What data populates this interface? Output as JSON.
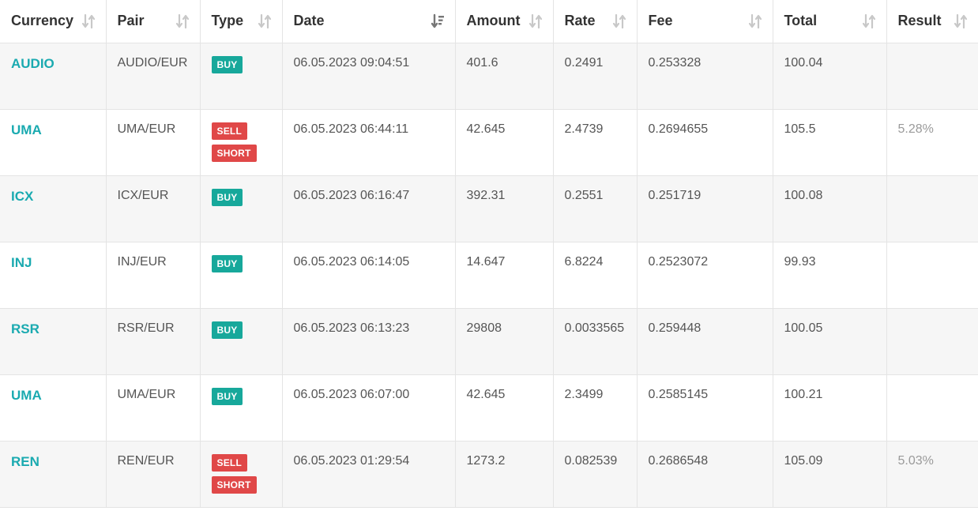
{
  "columns": [
    {
      "key": "currency",
      "label": "Currency",
      "sort": "none"
    },
    {
      "key": "pair",
      "label": "Pair",
      "sort": "none"
    },
    {
      "key": "type",
      "label": "Type",
      "sort": "none"
    },
    {
      "key": "date",
      "label": "Date",
      "sort": "desc-active"
    },
    {
      "key": "amount",
      "label": "Amount",
      "sort": "none"
    },
    {
      "key": "rate",
      "label": "Rate",
      "sort": "none"
    },
    {
      "key": "fee",
      "label": "Fee",
      "sort": "none"
    },
    {
      "key": "total",
      "label": "Total",
      "sort": "none"
    },
    {
      "key": "result",
      "label": "Result",
      "sort": "none"
    }
  ],
  "rows": [
    {
      "currency": "AUDIO",
      "pair": "AUDIO/EUR",
      "types": [
        "BUY"
      ],
      "date": "06.05.2023 09:04:51",
      "amount": "401.6",
      "rate": "0.2491",
      "fee": "0.253328",
      "total": "100.04",
      "result": ""
    },
    {
      "currency": "UMA",
      "pair": "UMA/EUR",
      "types": [
        "SELL",
        "SHORT"
      ],
      "date": "06.05.2023 06:44:11",
      "amount": "42.645",
      "rate": "2.4739",
      "fee": "0.2694655",
      "total": "105.5",
      "result": "5.28%"
    },
    {
      "currency": "ICX",
      "pair": "ICX/EUR",
      "types": [
        "BUY"
      ],
      "date": "06.05.2023 06:16:47",
      "amount": "392.31",
      "rate": "0.2551",
      "fee": "0.251719",
      "total": "100.08",
      "result": ""
    },
    {
      "currency": "INJ",
      "pair": "INJ/EUR",
      "types": [
        "BUY"
      ],
      "date": "06.05.2023 06:14:05",
      "amount": "14.647",
      "rate": "6.8224",
      "fee": "0.2523072",
      "total": "99.93",
      "result": ""
    },
    {
      "currency": "RSR",
      "pair": "RSR/EUR",
      "types": [
        "BUY"
      ],
      "date": "06.05.2023 06:13:23",
      "amount": "29808",
      "rate": "0.0033565",
      "fee": "0.259448",
      "total": "100.05",
      "result": ""
    },
    {
      "currency": "UMA",
      "pair": "UMA/EUR",
      "types": [
        "BUY"
      ],
      "date": "06.05.2023 06:07:00",
      "amount": "42.645",
      "rate": "2.3499",
      "fee": "0.2585145",
      "total": "100.21",
      "result": ""
    },
    {
      "currency": "REN",
      "pair": "REN/EUR",
      "types": [
        "SELL",
        "SHORT"
      ],
      "date": "06.05.2023 01:29:54",
      "amount": "1273.2",
      "rate": "0.082539",
      "fee": "0.2686548",
      "total": "105.09",
      "result": "5.03%"
    }
  ],
  "colors": {
    "accent": "#1aaab0",
    "buy": "#17a89b",
    "sell": "#e04848",
    "stripe": "#f6f6f6",
    "sort_inactive": "#c8c8c8",
    "sort_active": "#777777"
  },
  "icons": {
    "sort_inactive": "sort-arrows-icon",
    "sort_active": "sort-descending-icon"
  }
}
